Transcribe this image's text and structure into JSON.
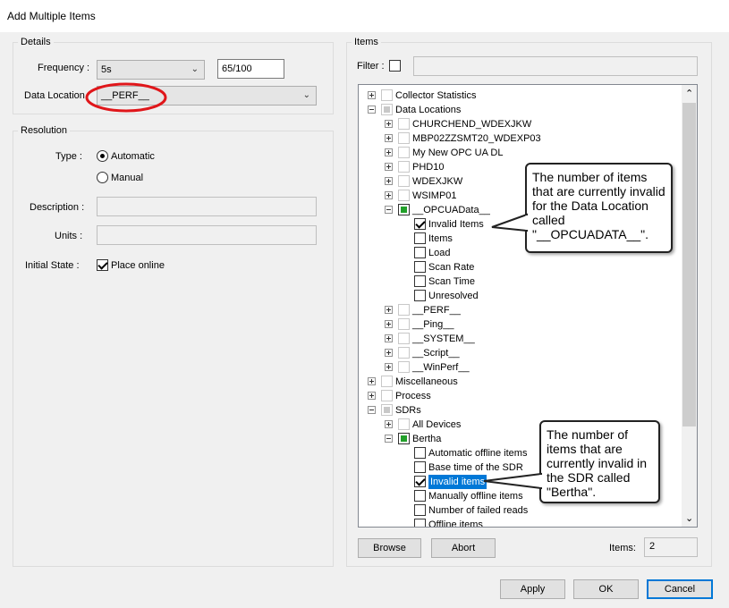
{
  "window": {
    "title": "Add Multiple Items"
  },
  "details": {
    "title": "Details",
    "frequency_label": "Frequency :",
    "frequency_value": "5s",
    "counter": "65/100",
    "data_location_label": "Data Location",
    "data_location_value": "__PERF__"
  },
  "resolution": {
    "title": "Resolution",
    "type_label": "Type :",
    "automatic": "Automatic",
    "manual": "Manual",
    "description_label": "Description :",
    "units_label": "Units :",
    "initial_state_label": "Initial State :",
    "place_online": "Place online"
  },
  "items": {
    "title": "Items",
    "filter_label": "Filter :",
    "tree": [
      {
        "label": "Collector Statistics",
        "level": 0,
        "exp": "plus",
        "chk": "gray"
      },
      {
        "label": "Data Locations",
        "level": 0,
        "exp": "minus",
        "chk": "part"
      },
      {
        "label": "CHURCHEND_WDEXJKW",
        "level": 1,
        "exp": "plus",
        "chk": "gray"
      },
      {
        "label": "MBP02ZZSMT20_WDEXP03",
        "level": 1,
        "exp": "plus",
        "chk": "gray"
      },
      {
        "label": "My New OPC UA DL",
        "level": 1,
        "exp": "plus",
        "chk": "gray"
      },
      {
        "label": "PHD10",
        "level": 1,
        "exp": "plus",
        "chk": "gray"
      },
      {
        "label": "WDEXJKW",
        "level": 1,
        "exp": "plus",
        "chk": "gray"
      },
      {
        "label": "WSIMP01",
        "level": 1,
        "exp": "plus",
        "chk": "gray"
      },
      {
        "label": "__OPCUAData__",
        "level": 1,
        "exp": "minus",
        "chk": "green"
      },
      {
        "label": "Invalid Items",
        "level": 2,
        "exp": "",
        "chk": "on"
      },
      {
        "label": "Items",
        "level": 2,
        "exp": "",
        "chk": "off"
      },
      {
        "label": "Load",
        "level": 2,
        "exp": "",
        "chk": "off"
      },
      {
        "label": "Scan Rate",
        "level": 2,
        "exp": "",
        "chk": "off"
      },
      {
        "label": "Scan Time",
        "level": 2,
        "exp": "",
        "chk": "off"
      },
      {
        "label": "Unresolved",
        "level": 2,
        "exp": "",
        "chk": "off"
      },
      {
        "label": "__PERF__",
        "level": 1,
        "exp": "plus",
        "chk": "gray"
      },
      {
        "label": "__Ping__",
        "level": 1,
        "exp": "plus",
        "chk": "gray"
      },
      {
        "label": "__SYSTEM__",
        "level": 1,
        "exp": "plus",
        "chk": "gray"
      },
      {
        "label": "__Script__",
        "level": 1,
        "exp": "plus",
        "chk": "gray"
      },
      {
        "label": "__WinPerf__",
        "level": 1,
        "exp": "plus",
        "chk": "gray"
      },
      {
        "label": "Miscellaneous",
        "level": 0,
        "exp": "plus",
        "chk": "gray"
      },
      {
        "label": "Process",
        "level": 0,
        "exp": "plus",
        "chk": "gray"
      },
      {
        "label": "SDRs",
        "level": 0,
        "exp": "minus",
        "chk": "part"
      },
      {
        "label": "All Devices",
        "level": 1,
        "exp": "plus",
        "chk": "gray"
      },
      {
        "label": "Bertha",
        "level": 1,
        "exp": "minus",
        "chk": "green"
      },
      {
        "label": "Automatic offline items",
        "level": 2,
        "exp": "",
        "chk": "off"
      },
      {
        "label": "Base time of the SDR",
        "level": 2,
        "exp": "",
        "chk": "off"
      },
      {
        "label": "Invalid items",
        "level": 2,
        "exp": "",
        "chk": "on",
        "selected": true
      },
      {
        "label": "Manually offline items",
        "level": 2,
        "exp": "",
        "chk": "off"
      },
      {
        "label": "Number of failed reads",
        "level": 2,
        "exp": "",
        "chk": "off"
      },
      {
        "label": "Offline items",
        "level": 2,
        "exp": "",
        "chk": "off"
      }
    ],
    "browse": "Browse",
    "abort": "Abort",
    "count_label": "Items:",
    "count_value": "2"
  },
  "callouts": {
    "opcua": "The number of items that are currently invalid for the Data Location called \"__OPCUADATA__\".",
    "bertha": "The number of items that are currently invalid in the SDR called \"Bertha\"."
  },
  "buttons": {
    "apply": "Apply",
    "ok": "OK",
    "cancel": "Cancel"
  },
  "colors": {
    "selection": "#0078d7",
    "highlight_ring": "#e0161a",
    "partial_green": "#22a02a"
  }
}
